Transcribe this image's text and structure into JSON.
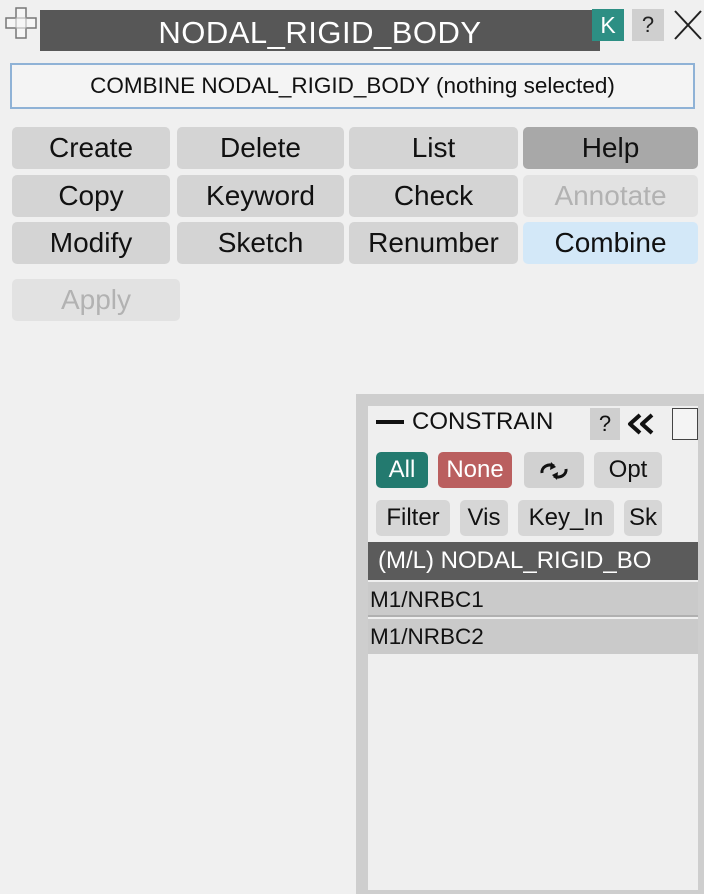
{
  "window": {
    "title": "NODAL_RIGID_BODY",
    "k_label": "K",
    "help_label": "?",
    "move_icon": "move-cross-icon",
    "close_icon": "close-x-icon"
  },
  "status": {
    "text": "COMBINE NODAL_RIGID_BODY (nothing selected)"
  },
  "buttons": {
    "create": "Create",
    "delete": "Delete",
    "list": "List",
    "help": "Help",
    "copy": "Copy",
    "keyword": "Keyword",
    "check": "Check",
    "annotate": "Annotate",
    "modify": "Modify",
    "sketch": "Sketch",
    "renumber": "Renumber",
    "combine": "Combine",
    "apply": "Apply"
  },
  "constrain_panel": {
    "title": "CONSTRAIN",
    "help_label": "?",
    "all": "All",
    "none": "None",
    "swap_icon": "swap-arrows-icon",
    "opt": "Opt",
    "filter": "Filter",
    "vis": "Vis",
    "key_in": "Key_In",
    "sk": "Sk",
    "list_header": "(M/L) NODAL_RIGID_BO",
    "items": [
      "M1/NRBC1",
      "M1/NRBC2"
    ]
  },
  "colors": {
    "title_bar": "#575757",
    "k_button": "#2d8f84",
    "all_chip": "#237a6f",
    "none_chip": "#ba5f5f",
    "active_button": "#d3e8f8",
    "status_border": "#8fb2d6"
  }
}
